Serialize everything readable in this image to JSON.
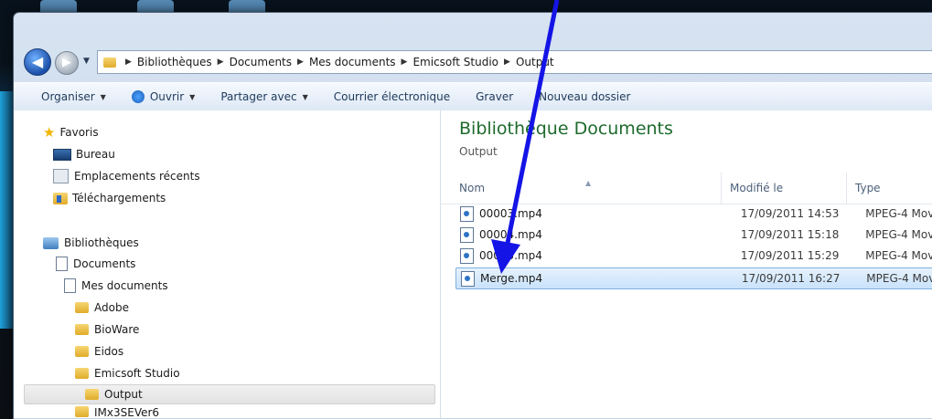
{
  "address_bar": {
    "crumbs": [
      "Bibliothèques",
      "Documents",
      "Mes documents",
      "Emicsoft Studio",
      "Output"
    ]
  },
  "toolbar": {
    "organiser": "Organiser",
    "ouvrir": "Ouvrir",
    "partager": "Partager avec",
    "courrier": "Courrier électronique",
    "graver": "Graver",
    "nouveau_dossier": "Nouveau dossier"
  },
  "nav": {
    "favoris": "Favoris",
    "bureau": "Bureau",
    "emplacements": "Emplacements récents",
    "telechargements": "Téléchargements",
    "bibliotheques": "Bibliothèques",
    "documents": "Documents",
    "mes_documents": "Mes documents",
    "adobe": "Adobe",
    "bioware": "BioWare",
    "eidos": "Eidos",
    "emicsoft": "Emicsoft Studio",
    "output": "Output",
    "imx": "IMx3SEVer6"
  },
  "content": {
    "title": "Bibliothèque Documents",
    "subtitle": "Output",
    "columns": {
      "name": "Nom",
      "modified": "Modifié le",
      "type": "Type"
    },
    "files": [
      {
        "name": "00003.mp4",
        "date": "17/09/2011 14:53",
        "type": "MPEG-4 Mov"
      },
      {
        "name": "00004.mp4",
        "date": "17/09/2011 15:18",
        "type": "MPEG-4 Mov"
      },
      {
        "name": "00005.mp4",
        "date": "17/09/2011 15:29",
        "type": "MPEG-4 Mov"
      },
      {
        "name": "Merge.mp4",
        "date": "17/09/2011 16:27",
        "type": "MPEG-4 Mov"
      }
    ]
  },
  "colors": {
    "title_green": "#1e6b2d",
    "arrow_blue": "#1414e6",
    "selection": "#c9e2fb"
  }
}
